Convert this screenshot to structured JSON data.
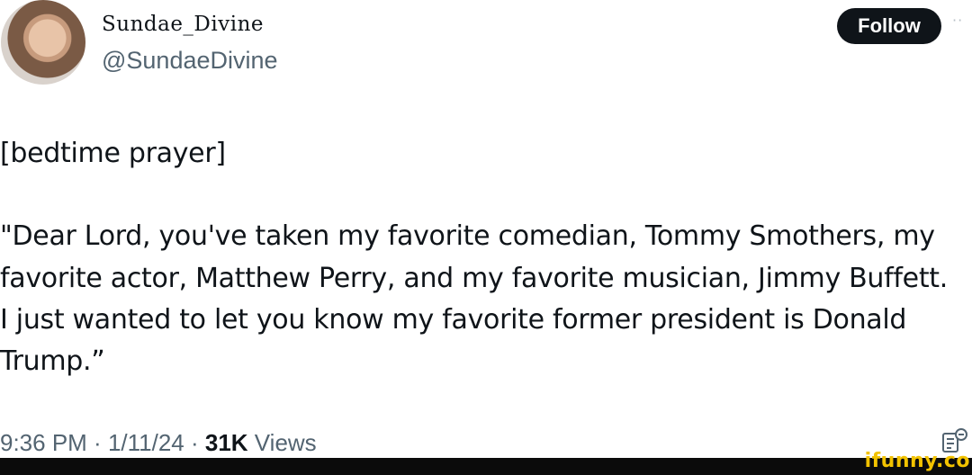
{
  "author": {
    "display_name": "Sundae_Divine",
    "handle": "@SundaeDivine"
  },
  "actions": {
    "follow_label": "Follow",
    "more_icon": "more-dots-icon"
  },
  "tweet": {
    "lines": [
      "[bedtime prayer]",
      "\"Dear Lord, you've taken my favorite comedian, Tommy Smothers, my",
      "favorite actor, Matthew Perry, and my favorite musician, Jimmy Buffett.",
      "I just wanted to let you know my favorite former president is Donald",
      "Trump.”"
    ]
  },
  "meta": {
    "time": "9:36 PM",
    "separator": " · ",
    "date": "1/11/24",
    "views_count": "31K",
    "views_label": " Views"
  },
  "watermark": "ifunny.co",
  "colors": {
    "text": "#0f1419",
    "secondary": "#536471",
    "button_bg": "#0f1419",
    "watermark": "#f2c200"
  }
}
